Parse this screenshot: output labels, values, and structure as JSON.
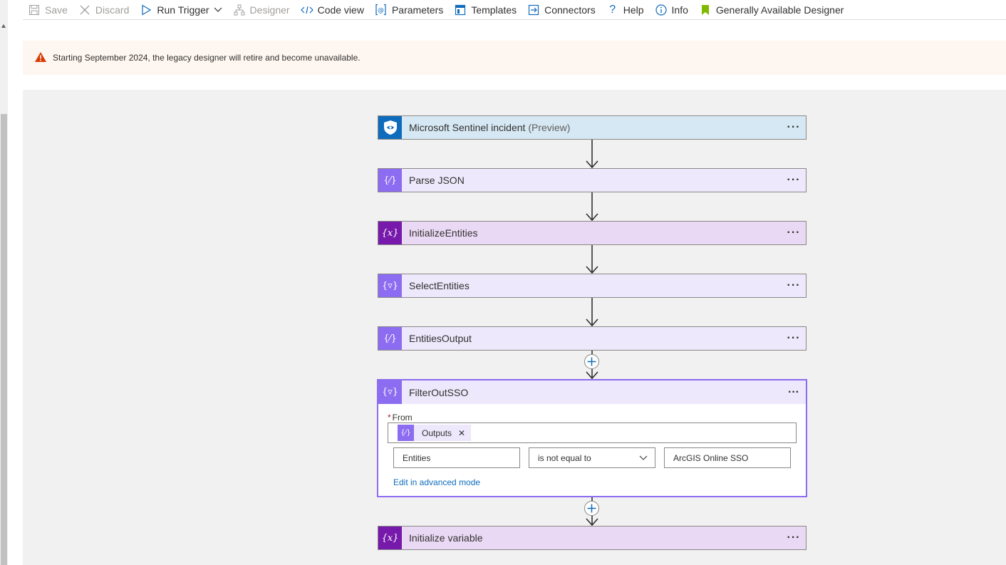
{
  "toolbar": {
    "save": "Save",
    "discard": "Discard",
    "run_trigger": "Run Trigger",
    "designer": "Designer",
    "code_view": "Code view",
    "parameters": "Parameters",
    "templates": "Templates",
    "connectors": "Connectors",
    "help": "Help",
    "info": "Info",
    "ga_designer": "Generally Available Designer"
  },
  "banner": {
    "message": "Starting September 2024, the legacy designer will retire and become unavailable."
  },
  "steps": [
    {
      "title": "Microsoft Sentinel incident",
      "suffix": "(Preview)",
      "kind": "sentinel-trigger"
    },
    {
      "title": "Parse JSON",
      "kind": "parse-json"
    },
    {
      "title": "InitializeEntities",
      "kind": "variable"
    },
    {
      "title": "SelectEntities",
      "kind": "select"
    },
    {
      "title": "EntitiesOutput",
      "kind": "compose"
    },
    {
      "title": "FilterOutSSO",
      "kind": "filter",
      "from_label": "From",
      "from_required_mark": "*",
      "from_token": "Outputs",
      "condition_left": "Entities",
      "condition_operator": "is not equal to",
      "condition_right": "ArcGIS Online SSO",
      "advanced_link": "Edit in advanced mode"
    },
    {
      "title": "Initialize variable",
      "kind": "variable"
    }
  ],
  "colors": {
    "sentinel_badge": "#0f6cbd",
    "compose_badge": "#8c6cf0",
    "variable_badge": "#7719aa",
    "link": "#0f6cbd",
    "warning": "#d83b01",
    "ga_flag": "#7fba00"
  }
}
